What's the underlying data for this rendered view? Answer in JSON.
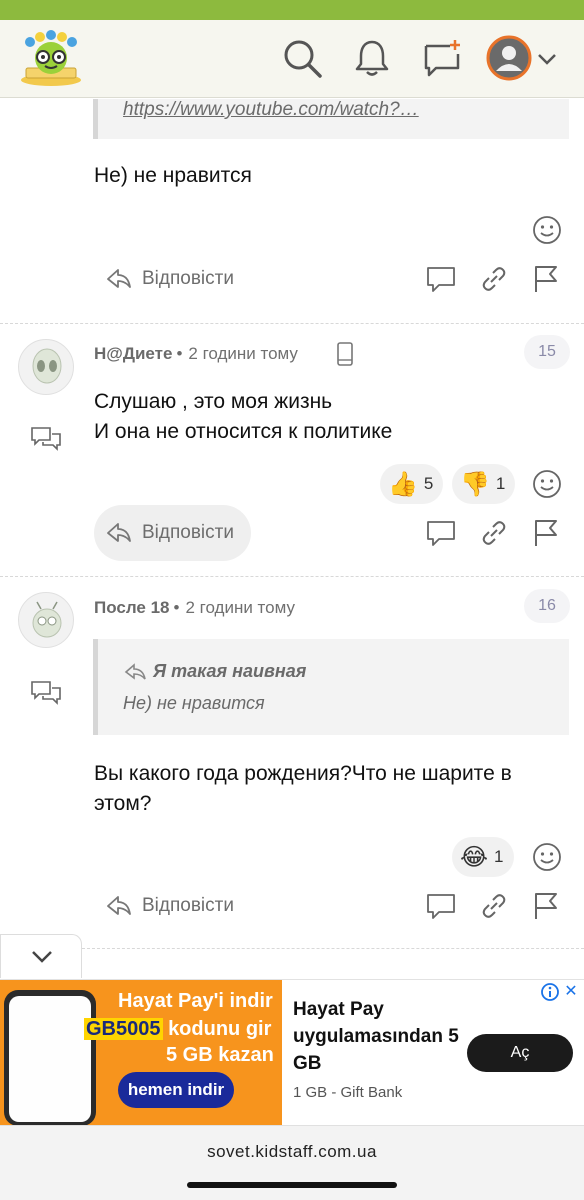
{
  "header": {
    "logo_alt": "KidStaff",
    "icons": [
      "search-icon",
      "bell-icon",
      "new-topic-icon",
      "user-avatar-icon",
      "chevron-down-icon"
    ]
  },
  "comments": [
    {
      "quote_link": "https://www.youtube.com/watch?…",
      "text_lines": [
        "Не) не нравится"
      ],
      "reply_label": "Відповісти"
    },
    {
      "author": "Н@Диете",
      "time": "2 години тому",
      "number": "15",
      "text_lines": [
        "Слушаю , это моя жизнь",
        "И она не относится к политике"
      ],
      "reactions": [
        {
          "emoji": "👍",
          "count": "5"
        },
        {
          "emoji": "👎",
          "count": "1"
        }
      ],
      "reply_label": "Відповісти"
    },
    {
      "author": "После 18",
      "time": "2 години тому",
      "number": "16",
      "quote_author": "Я такая наивная",
      "quote_text": "Не) не нравится",
      "text_lines": [
        "Вы какого года рождения?Что не шарите в",
        "этом?"
      ],
      "reactions": [
        {
          "emoji": "😂",
          "count": "1"
        }
      ],
      "reply_label": "Відповісти"
    }
  ],
  "ad": {
    "image_line1": "Hayat Pay'i indir",
    "image_code": "GB5005",
    "image_line2_rest": "kodunu gir",
    "image_line3": "5 GB kazan",
    "image_cta": "hemen indir",
    "title": "Hayat Pay uygulamasından 5 GB",
    "subtitle": "1 GB - Gift Bank",
    "button": "Aç",
    "close": "✕"
  },
  "browser": {
    "url": "sovet.kidstaff.com.ua"
  },
  "colors": {
    "brand_green": "#8dba3e",
    "avatar_ring": "#e8732a",
    "ad_orange": "#f7941d"
  }
}
